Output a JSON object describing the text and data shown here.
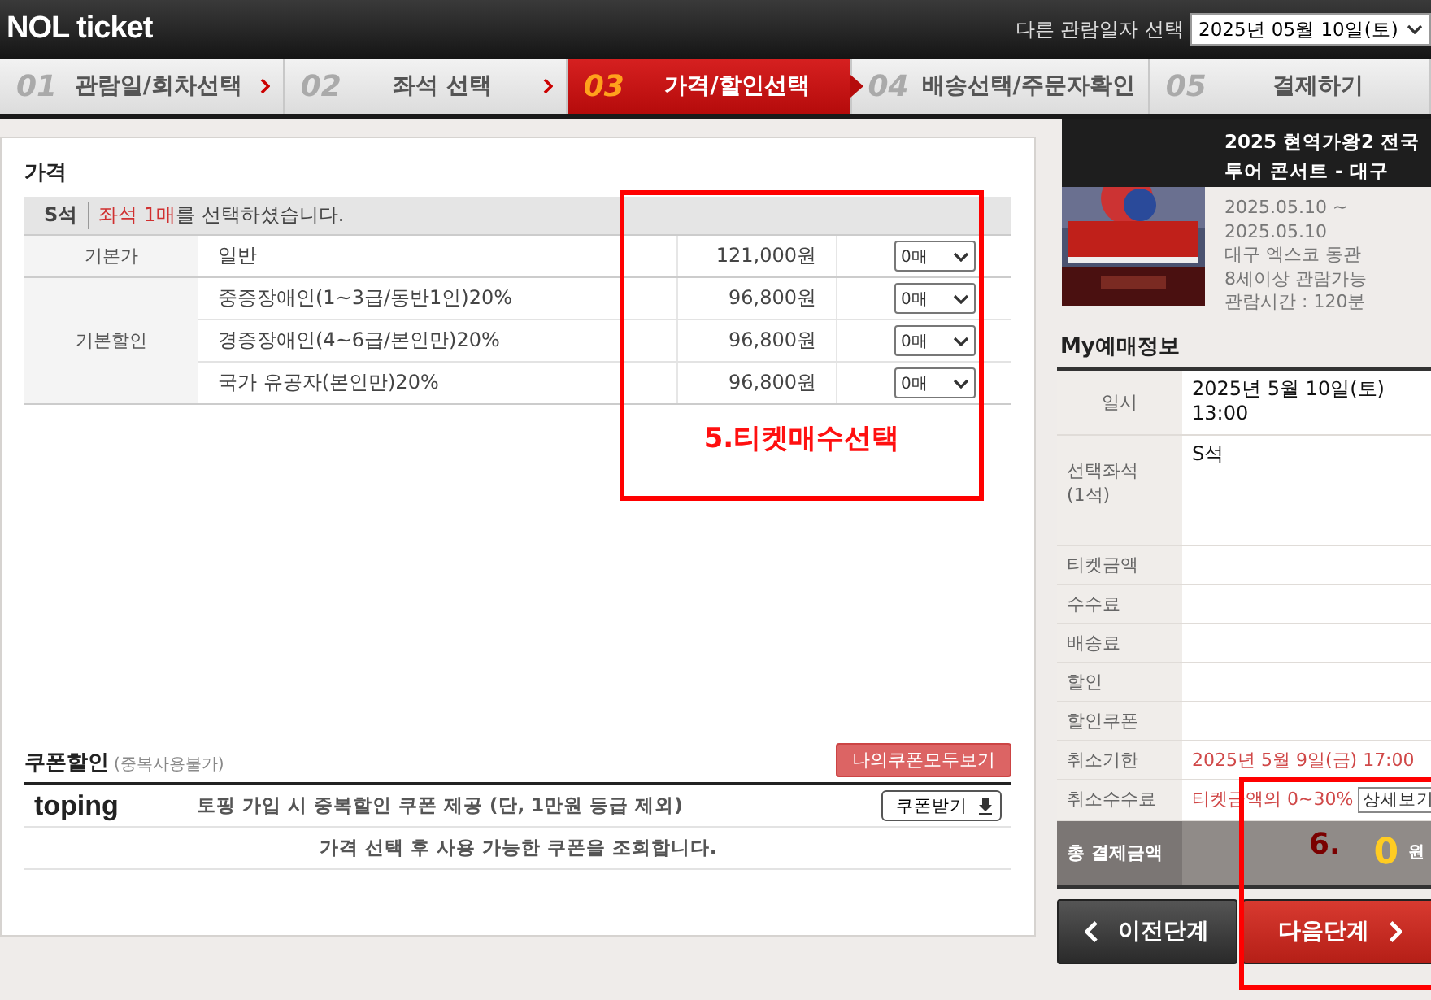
{
  "header": {
    "logo": "NOL ticket",
    "date_label": "다른 관람일자 선택",
    "date_value": "2025년 05월 10일(토)"
  },
  "steps": [
    {
      "number": "01",
      "label": "관람일/회차선택",
      "selected": false
    },
    {
      "number": "02",
      "label": "좌석 선택",
      "selected": false
    },
    {
      "number": "03",
      "label": "가격/할인선택",
      "selected": true
    },
    {
      "number": "04",
      "label": "배송선택/주문자확인",
      "selected": false
    },
    {
      "number": "05",
      "label": "결제하기",
      "selected": false
    }
  ],
  "price": {
    "title": "가격",
    "grade": "S석",
    "notice_highlight": "좌석 1매",
    "notice_rest": "를 선택하셨습니다.",
    "groups": [
      {
        "name": "기본가",
        "rows": [
          {
            "label": "일반",
            "price": "121,000원",
            "quantity": "0매"
          }
        ]
      },
      {
        "name": "기본할인",
        "rows": [
          {
            "label": "중증장애인(1~3급/동반1인)20%",
            "price": "96,800원",
            "quantity": "0매"
          },
          {
            "label": "경증장애인(4~6급/본인만)20%",
            "price": "96,800원",
            "quantity": "0매"
          },
          {
            "label": "국가 유공자(본인만)20%",
            "price": "96,800원",
            "quantity": "0매"
          }
        ]
      }
    ]
  },
  "coupon": {
    "title": "쿠폰할인",
    "note": "(중복사용불가)",
    "all_button": "나의쿠폰모두보기",
    "brand": "toping",
    "offer": "토핑 가입 시 중복할인 쿠폰 제공 (단, 1만원 등급 제외)",
    "get_button": "쿠폰받기",
    "message": "가격 선택 후 사용 가능한 쿠폰을 조회합니다."
  },
  "show": {
    "kind": "picture",
    "title": "2025 현역가왕2 전국투어 콘서트 - 대구",
    "period": "2025.05.10 ~ 2025.05.10",
    "venue": "대구 엑스코 동관",
    "age": "8세이상 관람가능",
    "runtime": "관람시간 : 120분"
  },
  "my_booking": {
    "title": "My예매정보",
    "rows": [
      {
        "label": "일시",
        "value": "2025년 5월 10일(토) 13:00",
        "kind": "plain"
      },
      {
        "label": "선택좌석\n(1석)",
        "value": "S석",
        "kind": "tall"
      },
      {
        "label": "티켓금액",
        "kind": "plain"
      },
      {
        "label": "수수료",
        "kind": "plain"
      },
      {
        "label": "배송료",
        "kind": "plain"
      },
      {
        "label": "할인",
        "kind": "plain"
      },
      {
        "label": "할인쿠폰",
        "kind": "plain"
      },
      {
        "label": "취소기한",
        "value": "2025년 5월 9일(금) 17:00",
        "kind": "alert"
      },
      {
        "label": "취소수수료",
        "value": "티켓금액의 0~30%",
        "button": "상세보기",
        "kind": "alert"
      }
    ],
    "total_label": "총 결제금액",
    "total_value": "0",
    "total_unit": "원"
  },
  "buttons": {
    "prev": "이전단계",
    "next": "다음단계"
  },
  "annotations": [
    {
      "label": "5.티켓매수선택"
    },
    {
      "label": "6."
    }
  ]
}
